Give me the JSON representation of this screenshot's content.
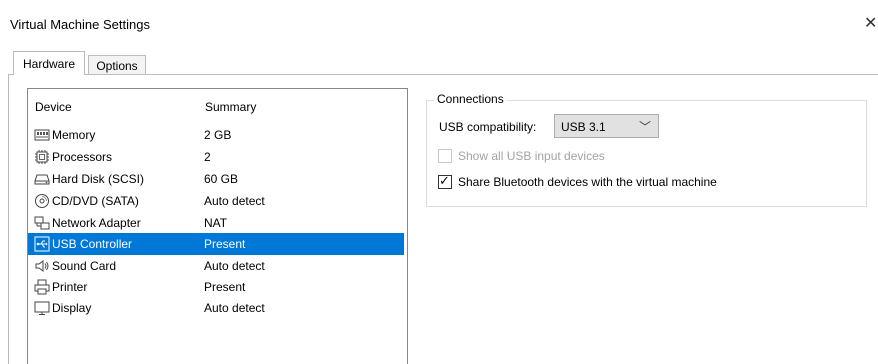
{
  "window": {
    "title": "Virtual Machine Settings",
    "close_glyph": "✕"
  },
  "tabs": [
    {
      "label": "Hardware",
      "active": true
    },
    {
      "label": "Options",
      "active": false
    }
  ],
  "device_list": {
    "columns": {
      "device": "Device",
      "summary": "Summary"
    },
    "rows": [
      {
        "icon": "memory-icon",
        "device": "Memory",
        "summary": "2 GB",
        "selected": false
      },
      {
        "icon": "processor-icon",
        "device": "Processors",
        "summary": "2",
        "selected": false
      },
      {
        "icon": "hard-disk-icon",
        "device": "Hard Disk (SCSI)",
        "summary": "60 GB",
        "selected": false
      },
      {
        "icon": "cd-dvd-icon",
        "device": "CD/DVD (SATA)",
        "summary": "Auto detect",
        "selected": false
      },
      {
        "icon": "network-adapter-icon",
        "device": "Network Adapter",
        "summary": "NAT",
        "selected": false
      },
      {
        "icon": "usb-controller-icon",
        "device": "USB Controller",
        "summary": "Present",
        "selected": true
      },
      {
        "icon": "sound-card-icon",
        "device": "Sound Card",
        "summary": "Auto detect",
        "selected": false
      },
      {
        "icon": "printer-icon",
        "device": "Printer",
        "summary": "Present",
        "selected": false
      },
      {
        "icon": "display-icon",
        "device": "Display",
        "summary": "Auto detect",
        "selected": false
      }
    ]
  },
  "connections": {
    "legend": "Connections",
    "usb_compat_label": "USB compatibility:",
    "usb_compat_value": "USB 3.1",
    "show_all_usb": {
      "label": "Show all USB input devices",
      "checked": false,
      "disabled": true
    },
    "share_bluetooth": {
      "label": "Share Bluetooth devices with the virtual machine",
      "checked": true,
      "disabled": false
    }
  },
  "colors": {
    "selection": "#0078d7",
    "disabled_text": "#a3a3a3"
  }
}
